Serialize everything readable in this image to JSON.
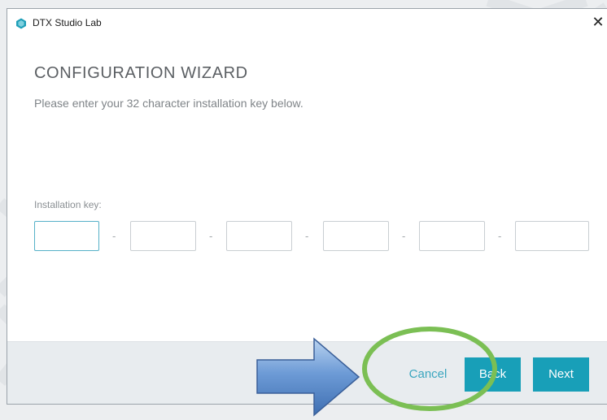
{
  "window": {
    "title": "DTX Studio Lab",
    "close_symbol": "✕",
    "icon_color": "#1f9fb8"
  },
  "wizard": {
    "title": "CONFIGURATION WIZARD",
    "subtitle": "Please enter your 32 character installation key below."
  },
  "installation_key": {
    "label": "Installation key:",
    "fields": [
      "",
      "",
      "",
      "",
      "",
      ""
    ],
    "separator": "-"
  },
  "footer": {
    "cancel_label": "Cancel",
    "back_label": "Back",
    "next_label": "Next"
  },
  "annotations": {
    "arrow_color": "#5f8fcc",
    "ellipse_color": "#7bbf54"
  },
  "colors": {
    "accent": "#189fb8"
  }
}
